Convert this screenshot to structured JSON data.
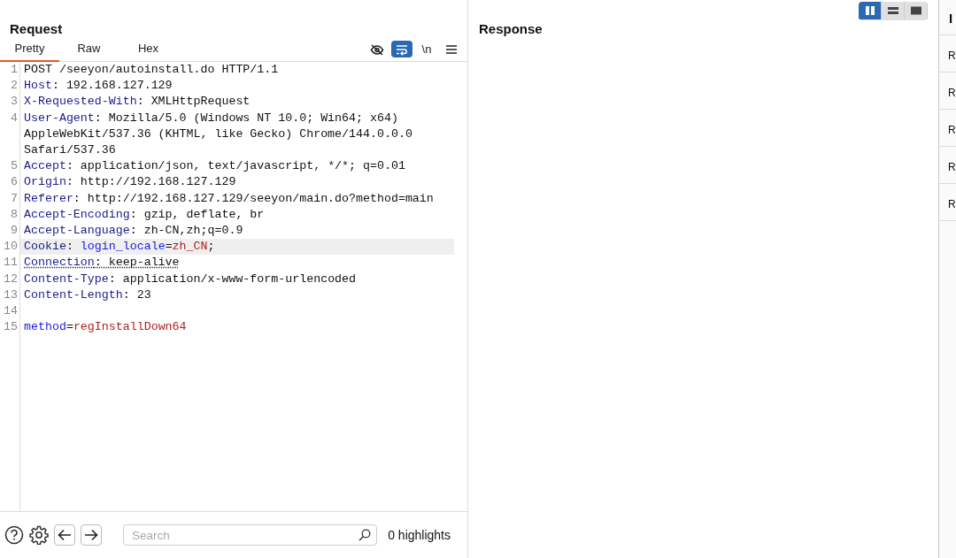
{
  "layout_toggle": [
    {
      "kind": "columns",
      "selected": true
    },
    {
      "kind": "rows",
      "selected": false
    },
    {
      "kind": "single",
      "selected": false
    }
  ],
  "request": {
    "title": "Request",
    "tabs": [
      {
        "label": "Pretty",
        "selected": true
      },
      {
        "label": "Raw",
        "selected": false
      },
      {
        "label": "Hex",
        "selected": false
      }
    ],
    "toolbar": [
      {
        "kind": "hide",
        "selected": false
      },
      {
        "kind": "wrap",
        "selected": true
      },
      {
        "kind": "newline",
        "label": "\\n",
        "selected": false
      },
      {
        "kind": "menu",
        "selected": false
      }
    ],
    "lines": [
      {
        "number": "1",
        "selected": false,
        "flagged": false,
        "parts": [
          {
            "kind": "plain",
            "text": "POST /seeyon/autoinstall.do HTTP/1.1"
          }
        ]
      },
      {
        "number": "2",
        "selected": false,
        "flagged": false,
        "parts": [
          {
            "kind": "key",
            "text": "Host"
          },
          {
            "kind": "plain",
            "text": ": 192.168.127.129"
          }
        ]
      },
      {
        "number": "3",
        "selected": false,
        "flagged": false,
        "parts": [
          {
            "kind": "key",
            "text": "X-Requested-With"
          },
          {
            "kind": "plain",
            "text": ": XMLHttpRequest"
          }
        ]
      },
      {
        "number": "4",
        "selected": false,
        "flagged": false,
        "parts": [
          {
            "kind": "key",
            "text": "User-Agent"
          },
          {
            "kind": "plain",
            "text": ": Mozilla/5.0 (Windows NT 10.0; Win64; x64) AppleWebKit/537.36 (KHTML, like Gecko) Chrome/144.0.0.0 Safari/537.36"
          }
        ]
      },
      {
        "number": "5",
        "selected": false,
        "flagged": false,
        "parts": [
          {
            "kind": "key",
            "text": "Accept"
          },
          {
            "kind": "plain",
            "text": ": application/json, text/javascript, */*; q=0.01"
          }
        ]
      },
      {
        "number": "6",
        "selected": false,
        "flagged": false,
        "parts": [
          {
            "kind": "key",
            "text": "Origin"
          },
          {
            "kind": "plain",
            "text": ": http://192.168.127.129"
          }
        ]
      },
      {
        "number": "7",
        "selected": false,
        "flagged": false,
        "parts": [
          {
            "kind": "key",
            "text": "Referer"
          },
          {
            "kind": "plain",
            "text": ": http://192.168.127.129/seeyon/main.do?method=main"
          }
        ]
      },
      {
        "number": "8",
        "selected": false,
        "flagged": false,
        "parts": [
          {
            "kind": "key",
            "text": "Accept-Encoding"
          },
          {
            "kind": "plain",
            "text": ": gzip, deflate, br"
          }
        ]
      },
      {
        "number": "9",
        "selected": false,
        "flagged": false,
        "parts": [
          {
            "kind": "key",
            "text": "Accept-Language"
          },
          {
            "kind": "plain",
            "text": ": zh-CN,zh;q=0.9"
          }
        ]
      },
      {
        "number": "10",
        "selected": true,
        "flagged": false,
        "parts": [
          {
            "kind": "key",
            "text": "Cookie"
          },
          {
            "kind": "plain",
            "text": ": "
          },
          {
            "kind": "param",
            "text": "login_locale"
          },
          {
            "kind": "plain",
            "text": "="
          },
          {
            "kind": "value",
            "text": "zh_CN"
          },
          {
            "kind": "plain",
            "text": ";"
          }
        ]
      },
      {
        "number": "11",
        "selected": false,
        "flagged": true,
        "parts": [
          {
            "kind": "key",
            "text": "Connection"
          },
          {
            "kind": "plain",
            "text": ": keep-alive"
          }
        ]
      },
      {
        "number": "12",
        "selected": false,
        "flagged": false,
        "parts": [
          {
            "kind": "key",
            "text": "Content-Type"
          },
          {
            "kind": "plain",
            "text": ": application/x-www-form-urlencoded"
          }
        ]
      },
      {
        "number": "13",
        "selected": false,
        "flagged": false,
        "parts": [
          {
            "kind": "key",
            "text": "Content-Length"
          },
          {
            "kind": "plain",
            "text": ": 23"
          }
        ]
      },
      {
        "number": "14",
        "selected": false,
        "flagged": false
      },
      {
        "number": "15",
        "selected": false,
        "flagged": false,
        "parts": [
          {
            "kind": "param",
            "text": "method"
          },
          {
            "kind": "plain",
            "text": "="
          },
          {
            "kind": "value",
            "text": "regInstallDown64"
          }
        ]
      }
    ],
    "search": {
      "placeholder": "Search"
    },
    "highlights": "0 highlights"
  },
  "response": {
    "title": "Response"
  },
  "inspector": {
    "title": "I",
    "rows": [
      "R",
      "R",
      "R",
      "R",
      "R"
    ]
  }
}
